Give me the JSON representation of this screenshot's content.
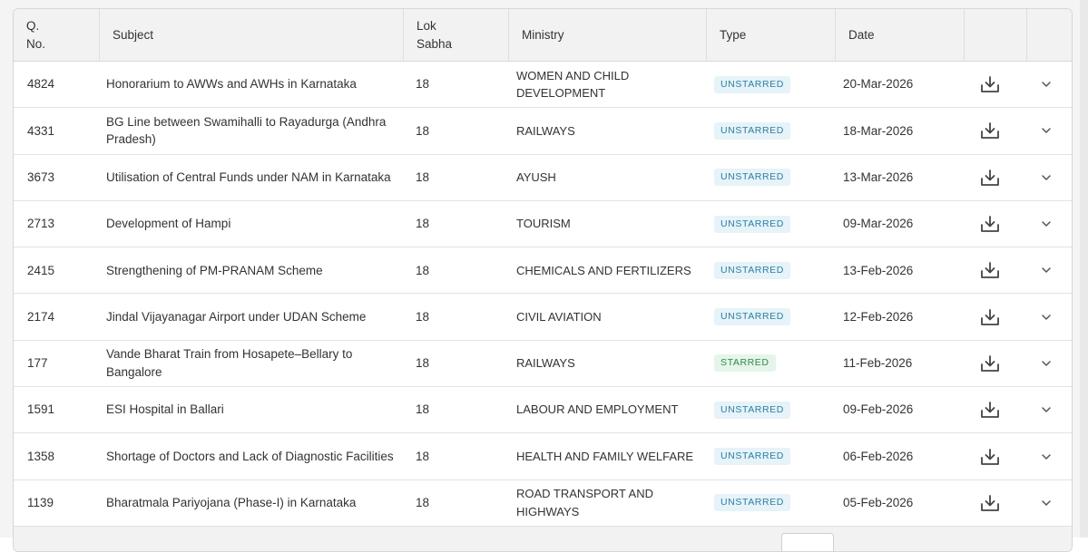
{
  "table": {
    "columns": {
      "qno": "Q.\nNo.",
      "subject": "Subject",
      "lok_sabha": "Lok\nSabha",
      "ministry": "Ministry",
      "type": "Type",
      "date": "Date"
    },
    "rows": [
      {
        "qno": "4824",
        "subject": "Honorarium to AWWs and AWHs in Karnataka",
        "lok": "18",
        "ministry": "WOMEN AND CHILD DEVELOPMENT",
        "type": "UNSTARRED",
        "date": "20-Mar-2026"
      },
      {
        "qno": "4331",
        "subject": "BG Line between Swamihalli to Rayadurga (Andhra Pradesh)",
        "lok": "18",
        "ministry": "RAILWAYS",
        "type": "UNSTARRED",
        "date": "18-Mar-2026"
      },
      {
        "qno": "3673",
        "subject": "Utilisation of Central Funds under NAM in Karnataka",
        "lok": "18",
        "ministry": "AYUSH",
        "type": "UNSTARRED",
        "date": "13-Mar-2026"
      },
      {
        "qno": "2713",
        "subject": "Development of Hampi",
        "lok": "18",
        "ministry": "TOURISM",
        "type": "UNSTARRED",
        "date": "09-Mar-2026"
      },
      {
        "qno": "2415",
        "subject": "Strengthening of PM-PRANAM Scheme",
        "lok": "18",
        "ministry": "CHEMICALS AND FERTILIZERS",
        "type": "UNSTARRED",
        "date": "13-Feb-2026"
      },
      {
        "qno": "2174",
        "subject": "Jindal Vijayanagar Airport under UDAN Scheme",
        "lok": "18",
        "ministry": "CIVIL AVIATION",
        "type": "UNSTARRED",
        "date": "12-Feb-2026"
      },
      {
        "qno": "177",
        "subject": "Vande Bharat Train from Hosapete–Bellary to Bangalore",
        "lok": "18",
        "ministry": "RAILWAYS",
        "type": "STARRED",
        "date": "11-Feb-2026"
      },
      {
        "qno": "1591",
        "subject": "ESI Hospital in Ballari",
        "lok": "18",
        "ministry": "LABOUR AND EMPLOYMENT",
        "type": "UNSTARRED",
        "date": "09-Feb-2026"
      },
      {
        "qno": "1358",
        "subject": "Shortage of Doctors and Lack of Diagnostic Facilities",
        "lok": "18",
        "ministry": "HEALTH AND FAMILY WELFARE",
        "type": "UNSTARRED",
        "date": "06-Feb-2026"
      },
      {
        "qno": "1139",
        "subject": "Bharatmala Pariyojana (Phase-I) in Karnataka",
        "lok": "18",
        "ministry": "ROAD TRANSPORT AND HIGHWAYS",
        "type": "UNSTARRED",
        "date": "05-Feb-2026"
      }
    ]
  },
  "icons": {
    "download": "download-icon",
    "expand": "chevron-down-icon"
  },
  "colors": {
    "unstarred_bg": "#e6f3f8",
    "unstarred_text": "#2b7ea3",
    "starred_bg": "#e5f5ea",
    "starred_text": "#2e8b4a",
    "header_bg": "#f2f2f2"
  }
}
